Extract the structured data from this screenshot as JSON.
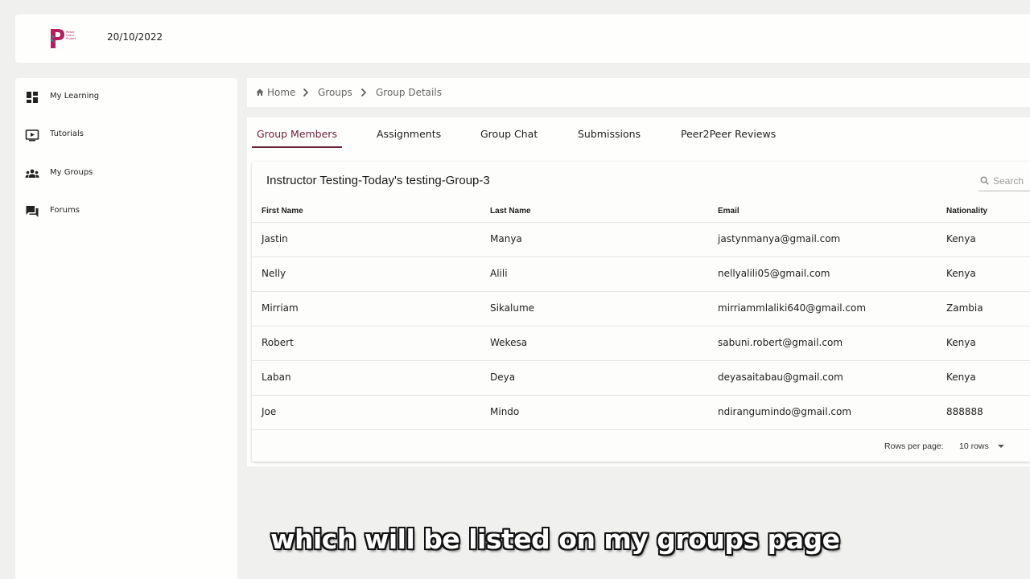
{
  "header": {
    "logo_text": "Power\nLearn\nProject",
    "date": "20/10/2022"
  },
  "sidebar": {
    "items": [
      {
        "label": "My Learning",
        "icon": "dashboard-icon"
      },
      {
        "label": "Tutorials",
        "icon": "video-play-icon"
      },
      {
        "label": "My Groups",
        "icon": "groups-icon"
      },
      {
        "label": "Forums",
        "icon": "forum-icon"
      }
    ]
  },
  "breadcrumb": {
    "items": [
      "Home",
      "Groups",
      "Group Details"
    ]
  },
  "tabs": [
    {
      "label": "Group Members",
      "active": true
    },
    {
      "label": "Assignments",
      "active": false
    },
    {
      "label": "Group Chat",
      "active": false
    },
    {
      "label": "Submissions",
      "active": false
    },
    {
      "label": "Peer2Peer Reviews",
      "active": false
    }
  ],
  "group": {
    "title": "Instructor Testing-Today's testing-Group-3",
    "search_placeholder": "Search"
  },
  "table": {
    "columns": [
      "First Name",
      "Last Name",
      "Email",
      "Nationality"
    ],
    "rows": [
      [
        "Jastin",
        "Manya",
        "jastynmanya@gmail.com",
        "Kenya"
      ],
      [
        "Nelly",
        "Alili",
        "nellyalili05@gmail.com",
        "Kenya"
      ],
      [
        "Mirriam",
        "Sikalume",
        "mirriammlaliki640@gmail.com",
        "Zambia"
      ],
      [
        "Robert",
        "Wekesa",
        "sabuni.robert@gmail.com",
        "Kenya"
      ],
      [
        "Laban",
        "Deya",
        "deyasaitabau@gmail.com",
        "Kenya"
      ],
      [
        "Joe",
        "Mindo",
        "ndirangumindo@gmail.com",
        "888888"
      ]
    ]
  },
  "pagination": {
    "rows_per_page_label": "Rows per page:",
    "rows_per_page_value": "10 rows"
  },
  "caption": "which will be listed on my groups page",
  "colors": {
    "accent": "#6b1d3a",
    "logo_primary": "#b4205d",
    "logo_secondary": "#1fa79b"
  }
}
